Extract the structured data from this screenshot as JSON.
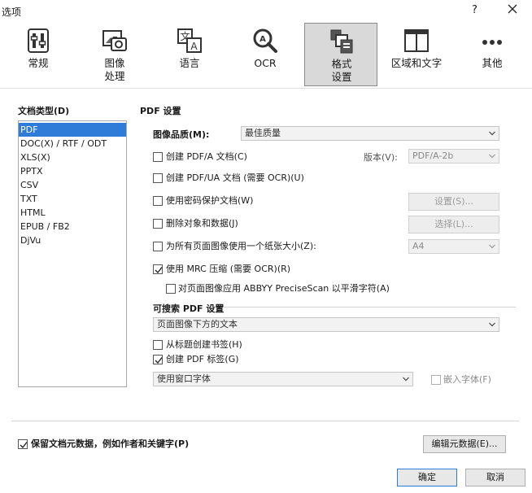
{
  "window": {
    "title": "选项",
    "help": "?",
    "close_icon": "close-icon"
  },
  "tabs": [
    {
      "label": "常规",
      "icon": "general-icon"
    },
    {
      "label": "图像\n处理",
      "icon": "image-icon"
    },
    {
      "label": "语言",
      "icon": "language-icon"
    },
    {
      "label": "OCR",
      "icon": "ocr-icon"
    },
    {
      "label": "格式\n设置",
      "icon": "format-icon",
      "active": true
    },
    {
      "label": "区域和文字",
      "icon": "areas-icon"
    },
    {
      "label": "其他",
      "icon": "more-icon"
    }
  ],
  "doc_types": {
    "label": "文档类型(D)",
    "items": [
      "PDF",
      "DOC(X) / RTF / ODT",
      "XLS(X)",
      "PPTX",
      "CSV",
      "TXT",
      "HTML",
      "EPUB / FB2",
      "DjVu"
    ],
    "selected": "PDF"
  },
  "pdf": {
    "title": "PDF 设置",
    "image_quality_label": "图像品质(M):",
    "image_quality_value": "最佳质量",
    "pdfa_label": "创建 PDF/A 文档(C)",
    "version_label": "版本(V):",
    "version_value": "PDF/A-2b",
    "pdfua_label": "创建 PDF/UA 文档 (需要 OCR)(U)",
    "password_label": "使用密码保护文档(W)",
    "settings_button": "设置(S)...",
    "delete_label": "删除对象和数据(J)",
    "select_button": "选择(L)...",
    "paper_label": "为所有页面图像使用一个纸张大小(Z):",
    "paper_value": "A4",
    "mrc_label": "使用 MRC 压缩 (需要 OCR)(R)",
    "mrc_checked": true,
    "precise_label": "对页面图像应用 ABBYY PreciseScan 以平滑字符(A)"
  },
  "searchable": {
    "title": "可搜索 PDF 设置",
    "mode_value": "页面图像下方的文本",
    "bookmarks_label": "从标题创建书签(H)",
    "tags_label": "创建 PDF 标签(G)",
    "tags_checked": true,
    "font_value": "使用窗口字体",
    "embed_label": "嵌入字体(F)"
  },
  "footer": {
    "metadata_label": "保留文档元数据，例如作者和关键字(P)",
    "metadata_checked": true,
    "edit_metadata_button": "编辑元数据(E)...",
    "ok_button": "确定",
    "cancel_button": "取消"
  }
}
